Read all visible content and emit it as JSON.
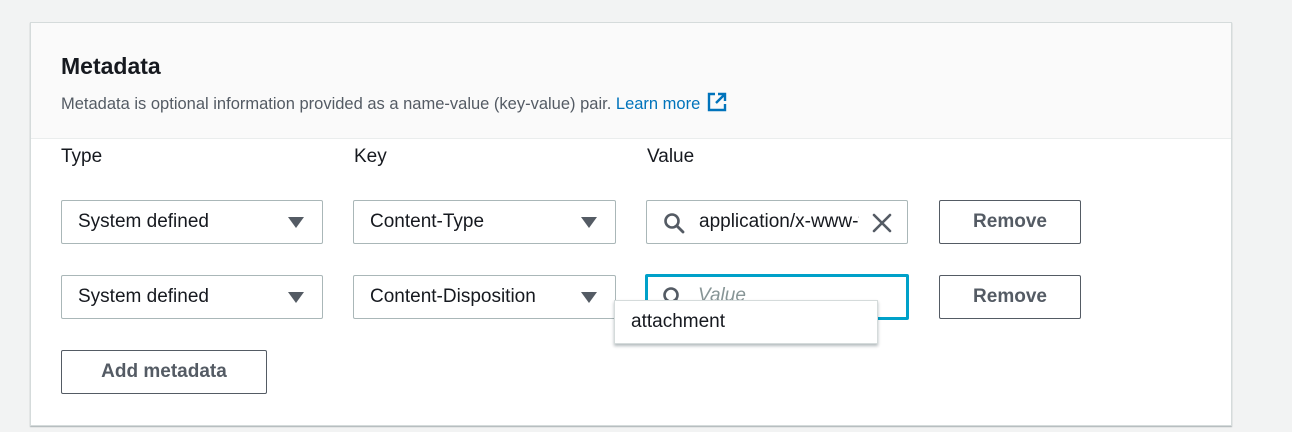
{
  "header": {
    "title": "Metadata",
    "description": "Metadata is optional information provided as a name-value (key-value) pair.",
    "learn_more": "Learn more"
  },
  "columns": {
    "type": "Type",
    "key": "Key",
    "value": "Value"
  },
  "rows": [
    {
      "type": "System defined",
      "key": "Content-Type",
      "value": "application/x-www-form-urlencoded",
      "remove": "Remove"
    },
    {
      "type": "System defined",
      "key": "Content-Disposition",
      "value": "",
      "value_placeholder": "Value",
      "remove": "Remove"
    }
  ],
  "suggestions": [
    "attachment"
  ],
  "add_button": "Add metadata",
  "icons": {
    "external": "external-link-icon",
    "search": "search-icon",
    "clear": "close-icon",
    "caret": "caret-down-icon"
  },
  "colors": {
    "link": "#0073bb",
    "focus": "#00a1c9"
  }
}
